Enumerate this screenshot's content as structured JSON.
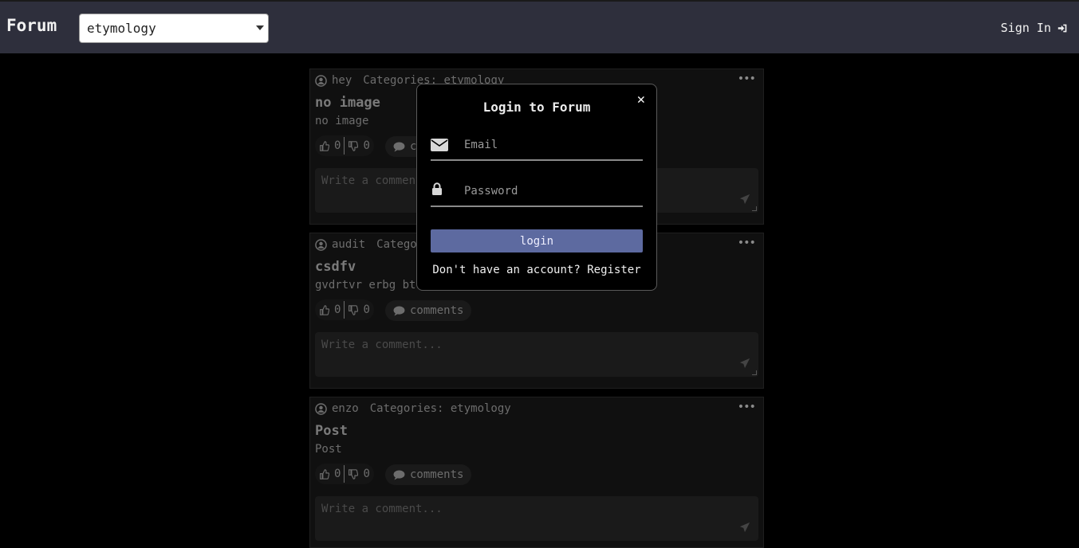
{
  "header": {
    "brand": "Forum",
    "category_selected": "etymology",
    "signin_label": "Sign In"
  },
  "posts": [
    {
      "author": "hey",
      "categories": "Categories: etymology",
      "title": "no image",
      "body": "no image",
      "likes": "0",
      "dislikes": "0",
      "comments_label": "comments",
      "comment_placeholder": "Write a comment..."
    },
    {
      "author": "audit",
      "categories": "Categories: etymology",
      "title": "csdfv",
      "body": "gvdrtvr erbg btr ty jy ty",
      "likes": "0",
      "dislikes": "0",
      "comments_label": "comments",
      "comment_placeholder": "Write a comment..."
    },
    {
      "author": "enzo",
      "categories": "Categories: etymology",
      "title": "Post",
      "body": "Post",
      "likes": "0",
      "dislikes": "0",
      "comments_label": "comments",
      "comment_placeholder": "Write a comment..."
    }
  ],
  "modal": {
    "title": "Login to Forum",
    "close_glyph": "✕",
    "email_placeholder": "Email",
    "password_placeholder": "Password",
    "login_label": "login",
    "register_prompt": "Don't have an account?",
    "register_link": "Register"
  },
  "colors": {
    "header_bg": "#2e2f3c",
    "login_button": "#5d6aa0",
    "page_bg": "#000000"
  }
}
